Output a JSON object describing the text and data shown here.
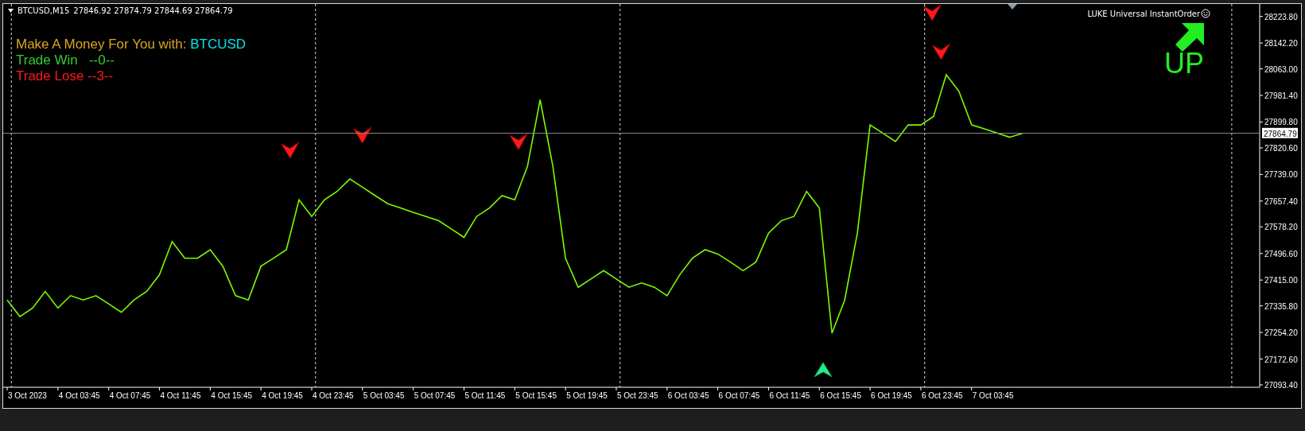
{
  "header": {
    "symbol": "BTCUSD,M15",
    "ohlc": "27846.92 27874.79 27844.69 27864.79"
  },
  "info": {
    "title": "Make A Money For You with: ",
    "symbol": "BTCUSD",
    "win": "Trade Win   --0--",
    "lose": "Trade Lose --3--"
  },
  "expert": {
    "name": "LUKE Universal InstantOrder",
    "signal": "UP"
  },
  "current_price": "27864.79",
  "time_labels": [
    "3 Oct 2023",
    "4 Oct 03:45",
    "4 Oct 07:45",
    "4 Oct 11:45",
    "4 Oct 15:45",
    "4 Oct 19:45",
    "4 Oct 23:45",
    "5 Oct 03:45",
    "5 Oct 07:45",
    "5 Oct 11:45",
    "5 Oct 15:45",
    "5 Oct 19:45",
    "5 Oct 23:45",
    "6 Oct 03:45",
    "6 Oct 07:45",
    "6 Oct 11:45",
    "6 Oct 15:45",
    "6 Oct 19:45",
    "6 Oct 23:45",
    "7 Oct 03:45"
  ],
  "chart_data": {
    "type": "line",
    "ylim": [
      27086,
      28262
    ],
    "series": [
      {
        "color": "#7cfc00",
        "values": [
          27354,
          27303,
          27329,
          27380,
          27329,
          27367,
          27354,
          27367,
          27342,
          27316,
          27354,
          27380,
          27431,
          27533,
          27482,
          27482,
          27508,
          27457,
          27367,
          27354,
          27457,
          27482,
          27508,
          27661,
          27610,
          27661,
          27687,
          27725,
          27700,
          27674,
          27649,
          27636,
          27623,
          27610,
          27597,
          27572,
          27546,
          27610,
          27636,
          27674,
          27661,
          27764,
          27968,
          27764,
          27482,
          27393,
          27418,
          27444,
          27418,
          27393,
          27406,
          27393,
          27367,
          27431,
          27482,
          27508,
          27495,
          27470,
          27444,
          27470,
          27559,
          27597,
          27610,
          27687,
          27636,
          27252,
          27354,
          27559,
          27891,
          27866,
          27840,
          27891,
          27891,
          27917,
          28045,
          27994,
          27891,
          27879,
          27866,
          27853,
          27865
        ]
      }
    ],
    "yticks": [
      {
        "value": 28223.8,
        "label": "28223.80"
      },
      {
        "value": 28142.2,
        "label": "28142.20"
      },
      {
        "value": 28063.0,
        "label": "28063.00"
      },
      {
        "value": 27981.4,
        "label": "27981.40"
      },
      {
        "value": 27899.8,
        "label": "27899.80"
      },
      {
        "value": 27820.6,
        "label": "27820.60"
      },
      {
        "value": 27739.0,
        "label": "27739.00"
      },
      {
        "value": 27657.4,
        "label": "27657.40"
      },
      {
        "value": 27578.2,
        "label": "27578.20"
      },
      {
        "value": 27496.6,
        "label": "27496.60"
      },
      {
        "value": 27415.0,
        "label": "27415.00"
      },
      {
        "value": 27335.8,
        "label": "27335.80"
      },
      {
        "value": 27254.2,
        "label": "27254.20"
      },
      {
        "value": 27172.6,
        "label": "27172.60"
      },
      {
        "value": 27093.4,
        "label": "27093.40"
      }
    ]
  }
}
